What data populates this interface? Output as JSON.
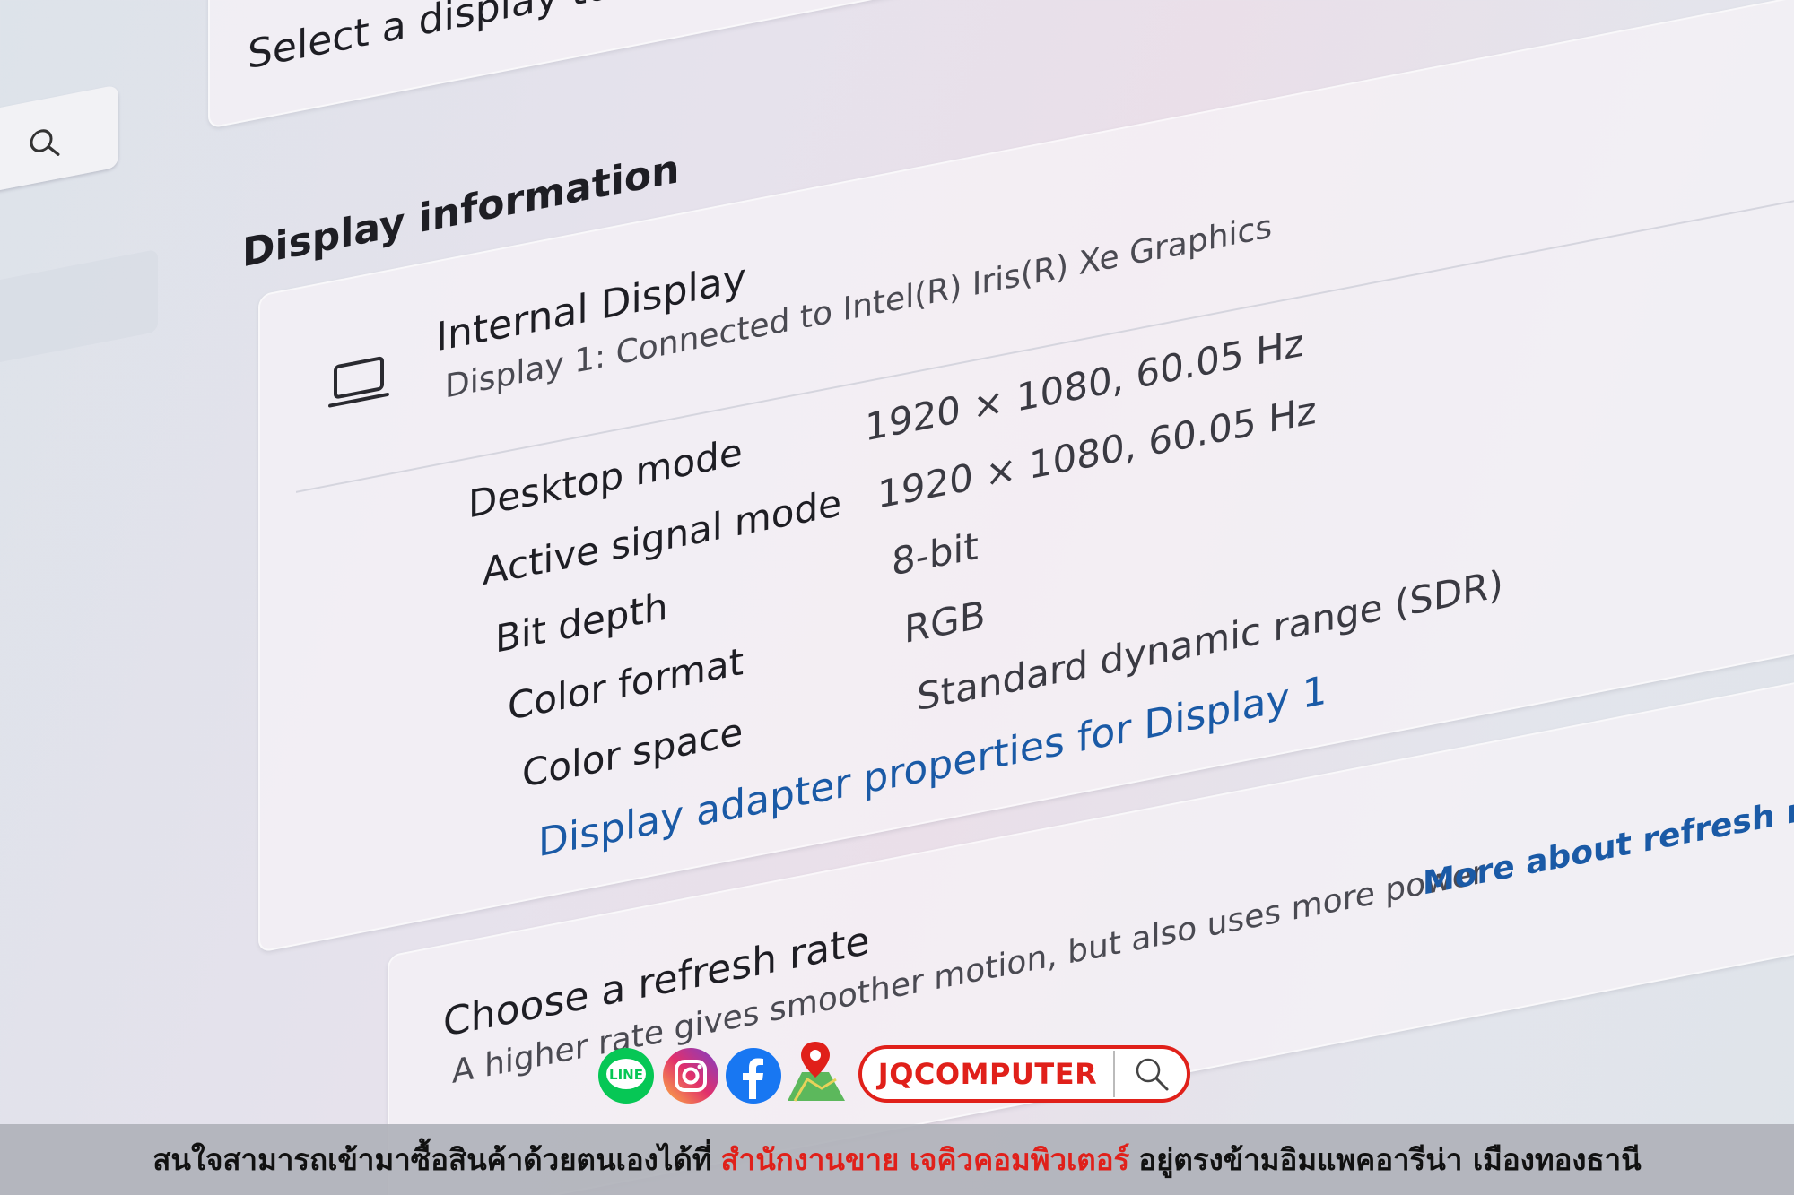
{
  "top_panel": {
    "text": "Select a display to view or change"
  },
  "section_title": "Display information",
  "display_card": {
    "name": "Internal Display",
    "subtitle": "Display 1: Connected to Intel(R) Iris(R) Xe Graphics",
    "rows": [
      {
        "label": "Desktop mode",
        "value": "1920 × 1080, 60.05 Hz"
      },
      {
        "label": "Active signal mode",
        "value": "1920 × 1080, 60.05 Hz"
      },
      {
        "label": "Bit depth",
        "value": "8-bit"
      },
      {
        "label": "Color format",
        "value": "RGB"
      },
      {
        "label": "Color space",
        "value": "Standard dynamic range (SDR)"
      }
    ],
    "adapter_link": "Display adapter properties for Display 1"
  },
  "refresh_card": {
    "title": "Choose a refresh rate",
    "description_start": "A higher rate gives smoother motion, but also uses more power",
    "more_link": "More about refresh rate"
  },
  "overlay": {
    "brand": "JQCOMPUTER",
    "social_icons": [
      "line-icon",
      "instagram-icon",
      "facebook-icon",
      "map-pin-icon"
    ],
    "line_label": "LINE",
    "banner_prefix": "สนใจสามารถเข้ามาซื้อสินค้าด้วยตนเองได้ที่",
    "banner_highlight": "สำนักงานขาย เจคิวคอมพิวเตอร์",
    "banner_suffix": "อยู่ตรงข้ามอิมแพคอารีน่า เมืองทองธานี"
  },
  "colors": {
    "link": "#1a5aa6",
    "brand_red": "#e0201a"
  }
}
